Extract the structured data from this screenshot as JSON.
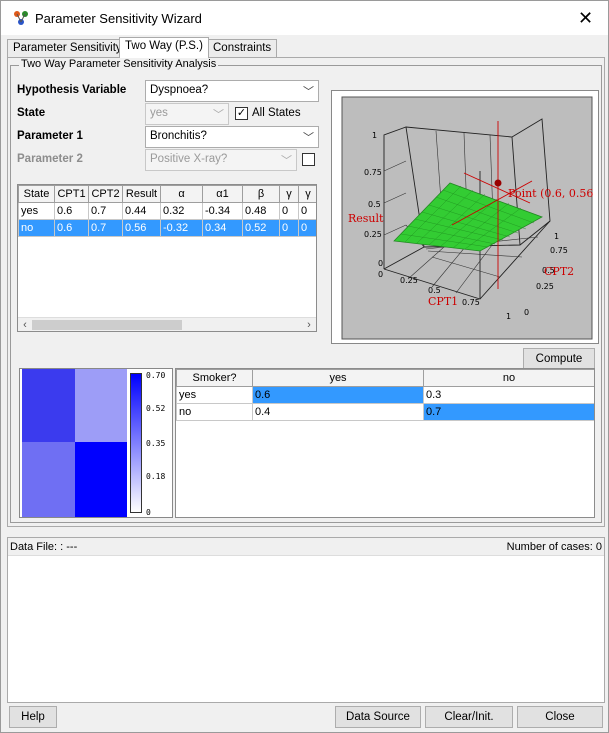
{
  "window": {
    "title": "Parameter Sensitivity Wizard",
    "close_glyph": "✕"
  },
  "tabs": [
    {
      "label": "Parameter Sensitivity"
    },
    {
      "label": "Two Way (P.S.)"
    },
    {
      "label": "Constraints"
    }
  ],
  "analysis": {
    "group_title": "Two Way Parameter Sensitivity Analysis",
    "hypothesis_label": "Hypothesis Variable",
    "hypothesis_value": "Dyspnoea?",
    "state_label": "State",
    "state_value": "yes",
    "all_states_label": "All States",
    "all_states_checked": true,
    "parameter1_label": "Parameter 1",
    "parameter1_value": "Bronchitis?",
    "parameter2_label": "Parameter 2",
    "parameter2_value": "Positive X-ray?",
    "parameter2_checked": false
  },
  "results_table": {
    "columns": [
      "State",
      "CPT1",
      "CPT2",
      "Result",
      "α",
      "α1",
      "β",
      "γ",
      "γ"
    ],
    "rows": [
      [
        "yes",
        "0.6",
        "0.7",
        "0.44",
        "0.32",
        "-0.34",
        "0.48",
        "0",
        "0"
      ],
      [
        "no",
        "0.6",
        "0.7",
        "0.56",
        "-0.32",
        "0.34",
        "0.52",
        "0",
        "0"
      ]
    ],
    "selected_row": 1
  },
  "plot": {
    "z_ticks": [
      "0",
      "0.25",
      "0.5",
      "0.75",
      "1"
    ],
    "x_ticks": [
      "0",
      "0.25",
      "0.5",
      "0.75",
      "1"
    ],
    "y_ticks": [
      "0",
      "0.25",
      "0.5",
      "0.75",
      "1"
    ],
    "z_label": "Result",
    "x_label": "CPT1",
    "y_label": "CPT2",
    "point_label": "Point (0.6, 0.56",
    "surface_color": "#33cc33"
  },
  "compute_button": "Compute",
  "heatmap": {
    "scale_ticks": [
      "0.70",
      "0.52",
      "0.35",
      "0.18",
      "0"
    ],
    "cells": [
      {
        "value": 0.6,
        "color": "#3b3bee"
      },
      {
        "value": 0.3,
        "color": "#9d9df7"
      },
      {
        "value": 0.4,
        "color": "#6f6ff3"
      },
      {
        "value": 0.7,
        "color": "#0000ff"
      }
    ]
  },
  "cpt_table": {
    "header": [
      "Smoker?",
      "yes",
      "no"
    ],
    "rows": [
      [
        "yes",
        "0.6",
        "0.3"
      ],
      [
        "no",
        "0.4",
        "0.7"
      ]
    ]
  },
  "data_panel": {
    "file_label": "Data File: : ---",
    "cases_label": "Number of cases: 0"
  },
  "buttons": {
    "help": "Help",
    "data_source": "Data Source",
    "clear": "Clear/Init.",
    "close": "Close"
  }
}
